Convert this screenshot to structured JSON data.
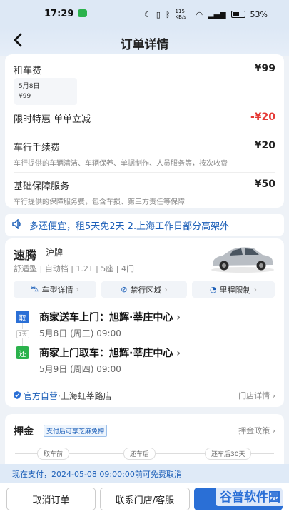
{
  "status_bar": {
    "time": "17:29",
    "battery": "53%",
    "net_speed": "115 KB/s"
  },
  "header": {
    "title": "订单详情",
    "back_icon": "chevron-left-icon"
  },
  "fees": [
    {
      "label": "租车费",
      "amount": "¥99",
      "chip_date": "5月8日",
      "chip_amount": "¥99"
    },
    {
      "label": "限时特惠 单单立减",
      "amount": "-¥20",
      "amount_color": "#e53935"
    },
    {
      "label": "车行手续费",
      "amount": "¥20",
      "desc": "车行提供的车辆清洁、车辆保养、单据制作、人员服务等，按次收费"
    },
    {
      "label": "基础保障服务",
      "amount": "¥50",
      "desc": "车行提供的保障服务费，包含车损、第三方责任等保障"
    }
  ],
  "notice": {
    "text": "多还便宜，租5天免2天 2.上海工作日部分高架外"
  },
  "car": {
    "name": "速腾",
    "plate": "沪牌",
    "tags": "舒适型 | 自动档 | 1.2T | 5座 | 4门",
    "actions": [
      {
        "label": "车型详情",
        "icon": "car-icon"
      },
      {
        "label": "禁行区域",
        "icon": "no-entry-icon"
      },
      {
        "label": "里程限制",
        "icon": "gauge-icon"
      }
    ]
  },
  "trip": {
    "pickup": {
      "badge": "取",
      "title": "商家送车上门：旭辉·莘庄中心",
      "date": "5月8日 (周三) 09:00"
    },
    "duration": "1天",
    "return": {
      "badge": "还",
      "title": "商家上门取车：旭辉·莘庄中心",
      "date": "5月9日 (周四) 09:00"
    }
  },
  "store": {
    "tag": "官方自营",
    "address": "·上海虹莘路店",
    "link": "门店详情"
  },
  "deposit": {
    "title": "押金",
    "badge": "支付后可享芝麻免押",
    "link": "押金政策",
    "timeline": [
      "取车前",
      "还车后",
      "还车后30天"
    ]
  },
  "pay_notice": "现在支付，2024-05-08 09:00:00前可免费取消",
  "buttons": {
    "cancel": "取消订单",
    "contact": "联系门店/客服"
  },
  "watermark": "谷普软件园",
  "colors": {
    "accent": "#2a6fd6",
    "discount": "#e53935",
    "pickup": "#2a6fd6",
    "return": "#2bb24c"
  }
}
